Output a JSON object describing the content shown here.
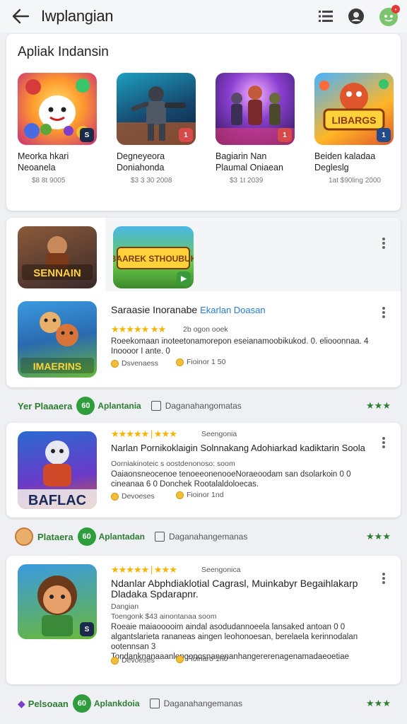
{
  "header": {
    "title": "Iwplangian"
  },
  "featured": {
    "title": "Apliak Indansin",
    "items": [
      {
        "name": "Meorka hkari Neoanela",
        "meta": "$8 8t 9005",
        "badge": "S"
      },
      {
        "name": "Degneyeora Doniahonda",
        "meta": "$3 3 30 2008",
        "badge": "1"
      },
      {
        "name": "Bagiarin Nan Plaumal Oniaean",
        "meta": "$3 1t 2039",
        "badge": "1"
      },
      {
        "name": "Beiden kaladaa Degleslg",
        "meta": "1at $90ling 2000",
        "badge": "1"
      }
    ]
  },
  "card2": {
    "thumb1_text": "SENNAIN",
    "thumb2_text": "BAAREK STHOUBUK",
    "item": {
      "title": "Saraasie Inoranabe",
      "accent": "Ekarlan Doasan",
      "thumb_text": "IMAERINS",
      "rating_text": "2b ogon ooek",
      "desc": "Roeekomaan inoteetonamorepon eseianamoobikukod. 0. eliooonnaa. 4 Inoooor I ante. 0",
      "foot1": "Dsvenaess",
      "foot2": "Fioinor 1 50"
    }
  },
  "strip1": {
    "label": "Yer Plaaaera",
    "circle": "60",
    "sub": "Aplantania",
    "text": "Daganahangomatas",
    "star": "★★★"
  },
  "card3": {
    "stars_extra": "| ★★★",
    "rating_text": "Seengonia",
    "title": "Narlan Pornikoklaigin Solnnakang Adohiarkad kadiktarin Soola",
    "sub": "Oorniakinoteic s oostdenonoso: soom",
    "desc": "Oaiaonsneocenoe tenoeeonenooeNoraeoodam san dsolarkoin 0 0 cineanaa 6 0 Donchek Rootalaldoloecas.",
    "thumb_text": "BAFLAC",
    "foot1": "Devoeses",
    "foot2": "Fioinor 1nd"
  },
  "strip2": {
    "label": "Plataera",
    "circle": "60",
    "sub": "Aplantadan",
    "text": "Daganahangemanas",
    "star": "★★★"
  },
  "card4": {
    "stars_extra": "| ★★★",
    "rating_text": "Seengonica",
    "title": "Ndanlar Abphdiaklotial Cagrasl, Muinkabyr Begaihlakarp Dladaka Spdarapnr.",
    "sub1": "Dangian",
    "sub2": "Toengonk $43 ainontanaa soom",
    "desc": "Roeaie maiaooooim aindal asodudannoeela lansaked antoan 0 0 algantslarieta rananeas aingen leohonoesan, berelaela kerinnodalan ootennsan 3 Tondanknanaaanlengonosnanenanhangererenagenamadaeoetiae",
    "foot1": "Devoeses",
    "foot2": "Fioinaro 1n0"
  },
  "strip3": {
    "label": "Pelsoaan",
    "circle": "60",
    "sub": "Aplankdoia",
    "text": "Daganahangemanas",
    "star": "★★★"
  }
}
